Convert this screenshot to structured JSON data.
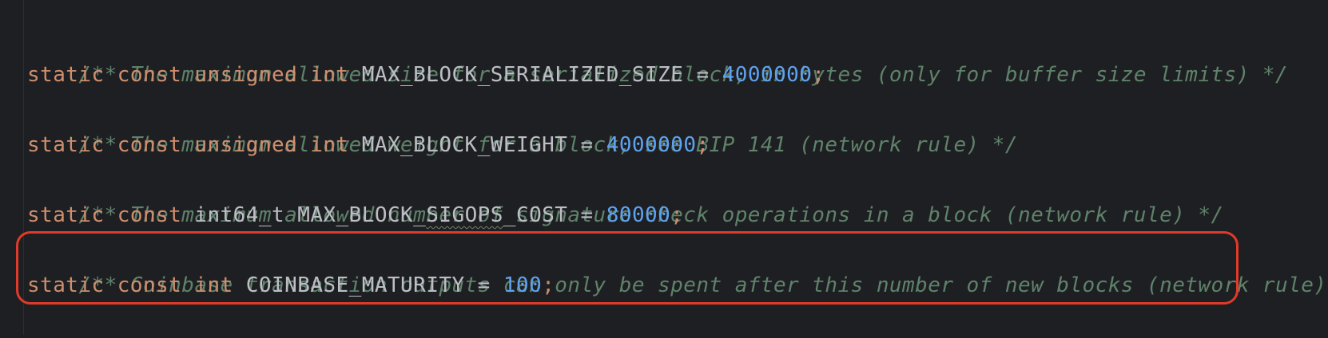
{
  "editor": {
    "lines": [
      {
        "comment": "/** The maximum allowed size for a serialized block, in bytes (only for buffer size limits) */"
      },
      {
        "kw1": "static",
        "kw2": "const",
        "kw3": "unsigned",
        "kw4": "int",
        "name": "MAX_BLOCK_SERIALIZED_SIZE",
        "op": "=",
        "value": "4000000",
        "semi": ";"
      },
      {
        "comment": "/** The maximum allowed weight for a block, see BIP 141 (network rule) */"
      },
      {
        "kw1": "static",
        "kw2": "const",
        "kw3": "unsigned",
        "kw4": "int",
        "name": "MAX_BLOCK_WEIGHT",
        "op": "=",
        "value": "4000000",
        "semi": ";"
      },
      {
        "comment": "/** The maximum allowed number of signature check operations in a block (network rule) */"
      },
      {
        "kw1": "static",
        "kw2": "const",
        "type": "int64_t",
        "name_pre": "MAX_BLOCK_",
        "name_squiggle": "SIGOPS",
        "name_post": "_COST",
        "op": "=",
        "value": "80000",
        "semi": ";"
      },
      {
        "comment": "/** Coinbase transaction outputs can only be spent after this number of new blocks (network rule) */"
      },
      {
        "kw1": "static",
        "kw2": "const",
        "kw3": "int",
        "name": "COINBASE_MATURITY",
        "op": "=",
        "value": "100",
        "semi": ";"
      }
    ]
  },
  "highlight": {
    "color": "#e03a2a"
  },
  "colors": {
    "background": "#1e1f22",
    "comment": "#5f826b",
    "keyword": "#cf8e6d",
    "identifier": "#bcbec4",
    "number": "#5ea2f0"
  }
}
